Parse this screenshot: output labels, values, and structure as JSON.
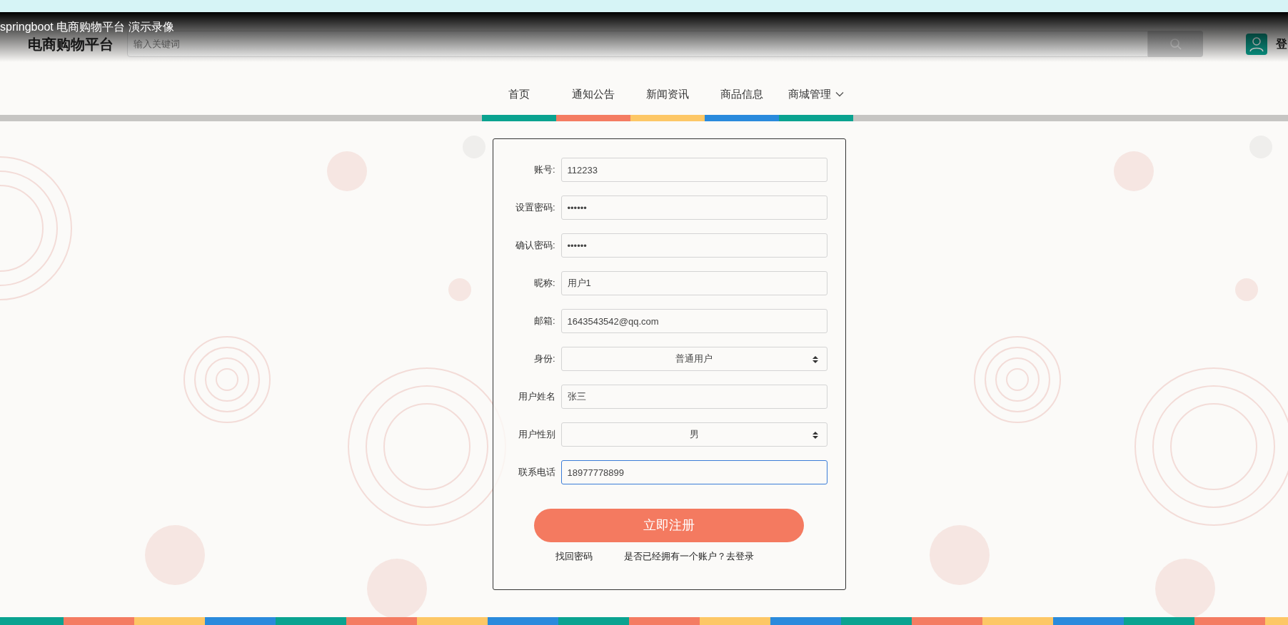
{
  "video_caption": "springboot 电商购物平台 演示录像",
  "header": {
    "logo": "电商购物平台",
    "search": {
      "placeholder": "输入关键词"
    },
    "login_partial": "登"
  },
  "nav": [
    {
      "label": "首页",
      "color": "#0aa390",
      "dropdown": false
    },
    {
      "label": "通知公告",
      "color": "#f47c62",
      "dropdown": false
    },
    {
      "label": "新闻资讯",
      "color": "#fdc766",
      "dropdown": false
    },
    {
      "label": "商品信息",
      "color": "#2a8adc",
      "dropdown": false
    },
    {
      "label": "商城管理",
      "color": "#0aa390",
      "dropdown": true
    }
  ],
  "form": {
    "fields": [
      {
        "label": "账号:",
        "kind": "text",
        "value": "112233",
        "focused": false
      },
      {
        "label": "设置密码:",
        "kind": "text",
        "value": "••••••",
        "focused": false
      },
      {
        "label": "确认密码:",
        "kind": "text",
        "value": "••••••",
        "focused": false
      },
      {
        "label": "昵称:",
        "kind": "text",
        "value": "用户1",
        "focused": false
      },
      {
        "label": "邮箱:",
        "kind": "text",
        "value": "1643543542@qq.com",
        "focused": false
      },
      {
        "label": "身份:",
        "kind": "select",
        "value": "普通用户",
        "focused": false
      },
      {
        "label": "用户姓名",
        "kind": "text",
        "value": "张三",
        "focused": false
      },
      {
        "label": "用户性别",
        "kind": "select",
        "value": "男",
        "focused": false
      },
      {
        "label": "联系电话",
        "kind": "text",
        "value": "18977778899",
        "focused": true
      }
    ],
    "submit": "立即注册",
    "links": [
      "找回密码",
      "是否已经拥有一个账户？去登录"
    ]
  }
}
